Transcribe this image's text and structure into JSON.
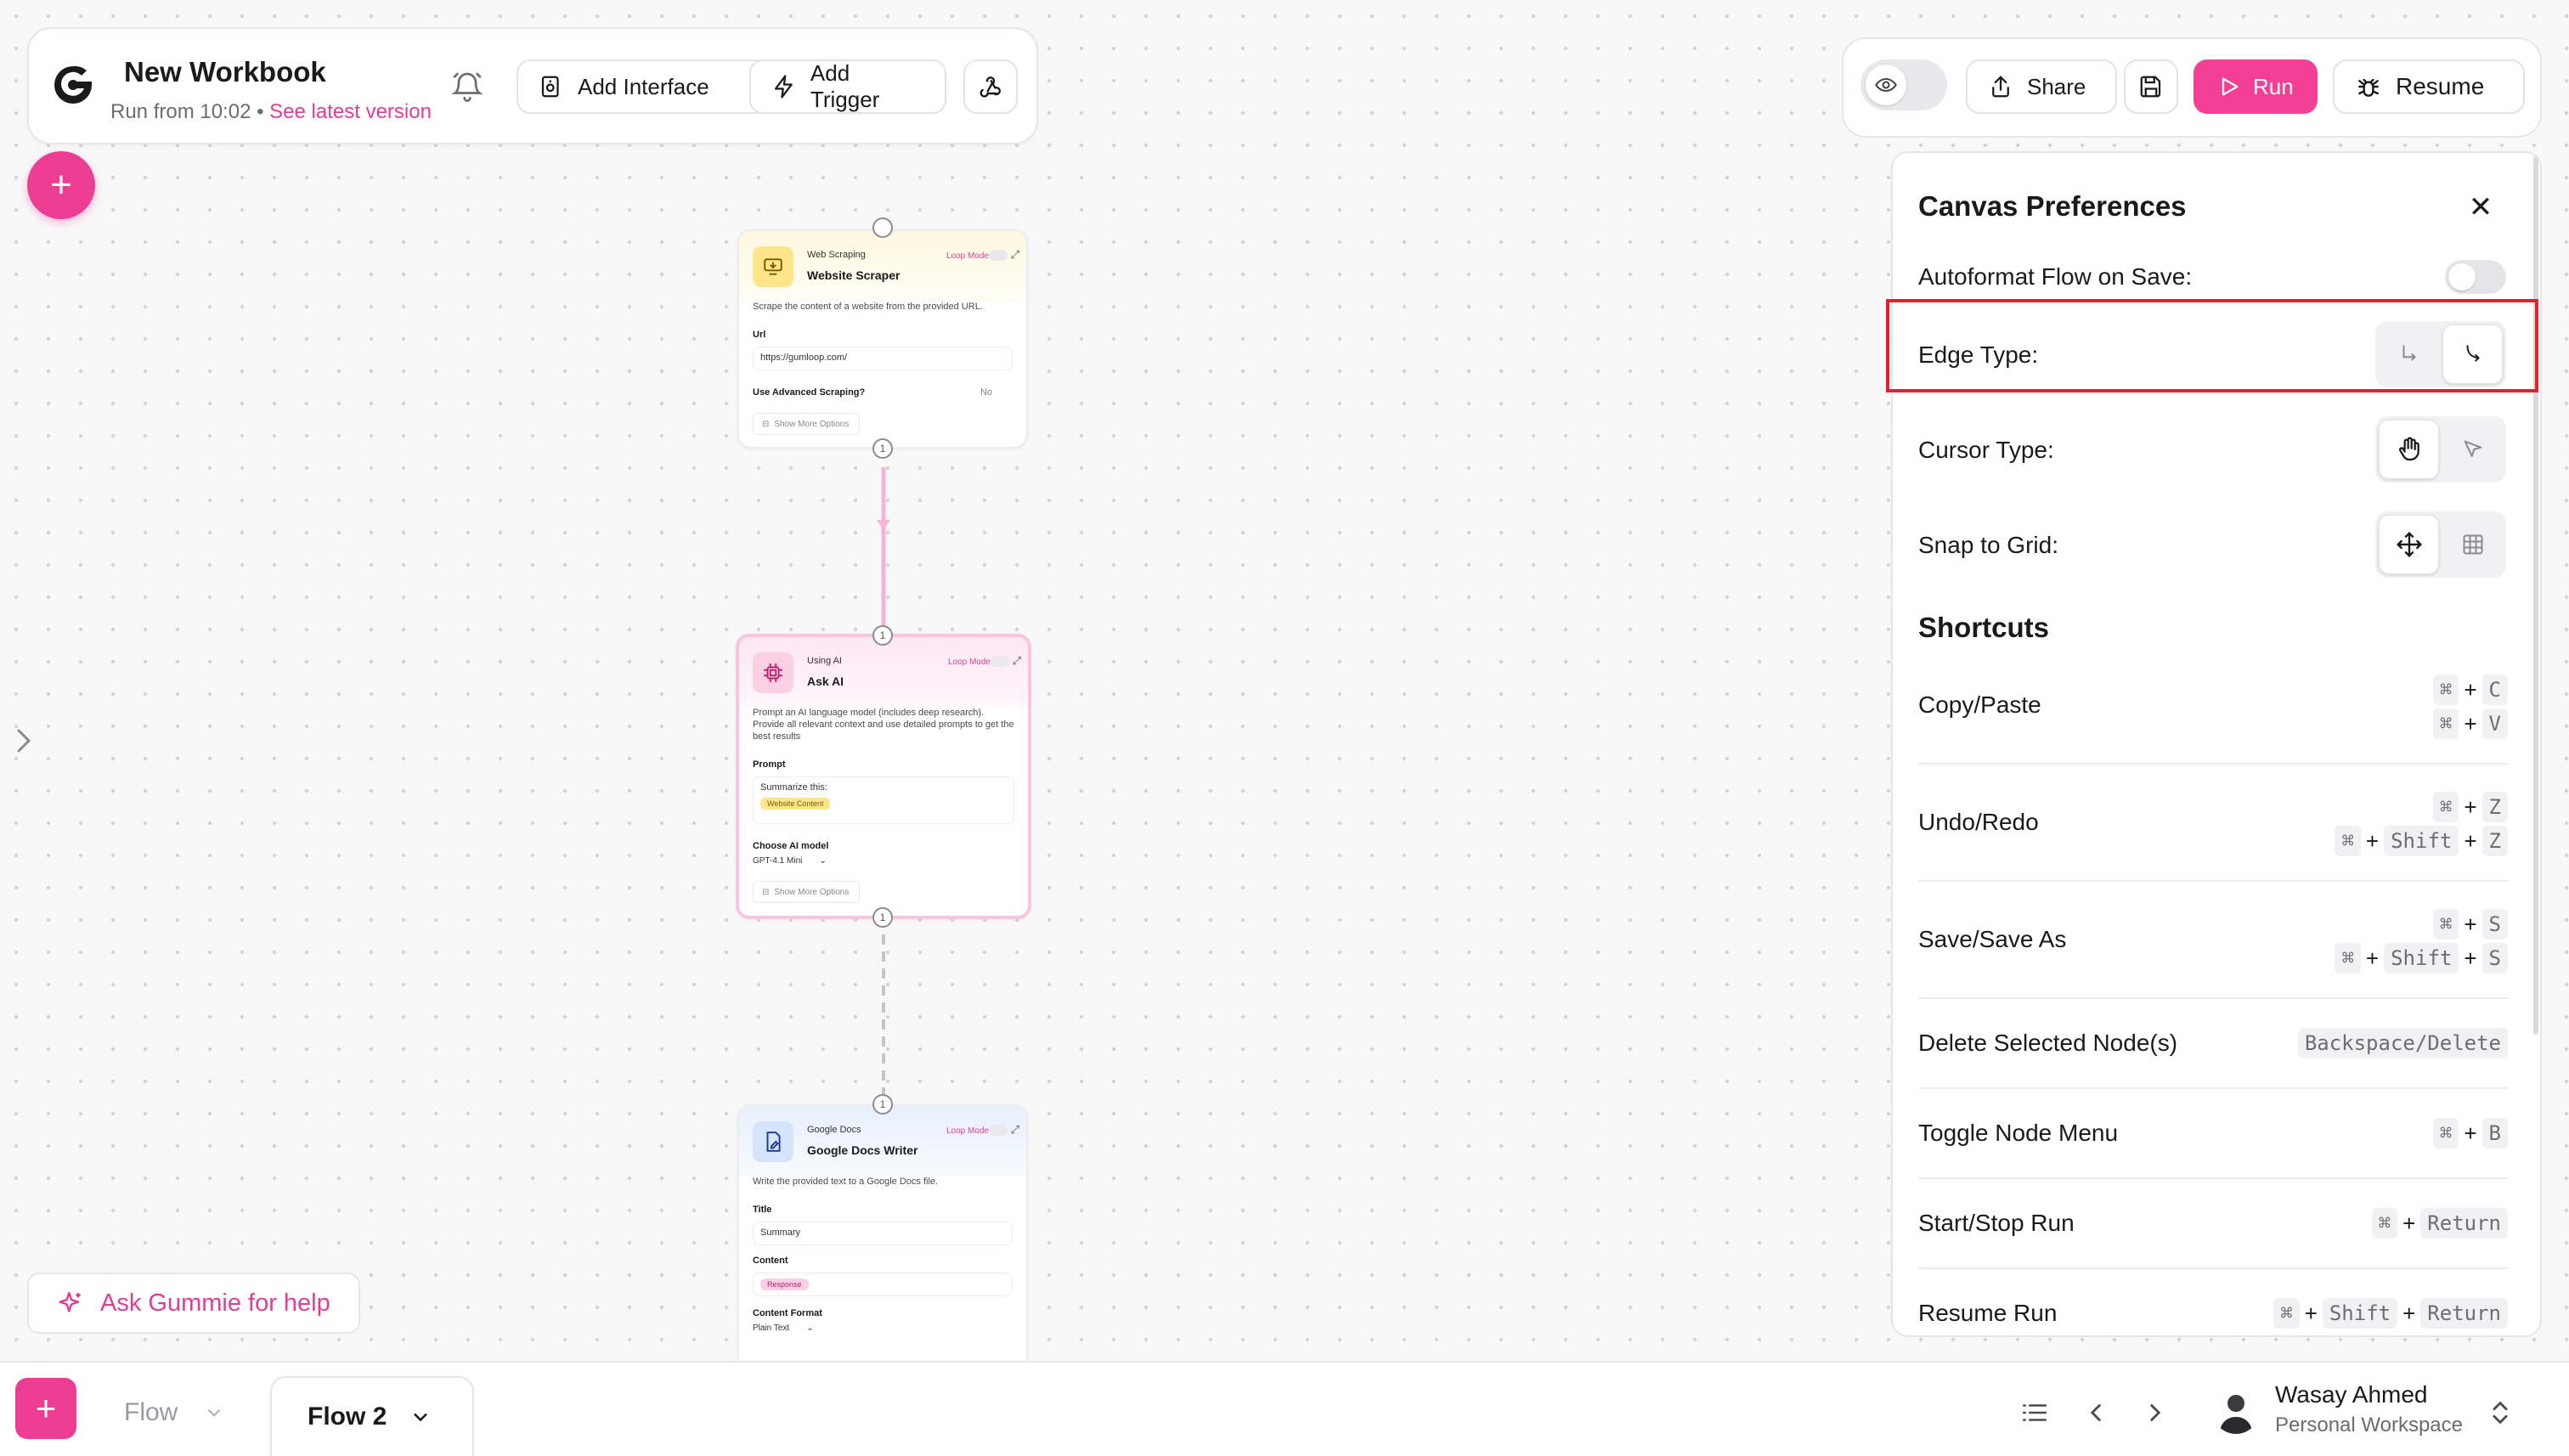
{
  "header": {
    "title": "New Workbook",
    "run_from": "Run from 10:02",
    "separator": "•",
    "latest_link": "See latest version",
    "add_interface": "Add Interface",
    "add_trigger": "Add Trigger"
  },
  "toolbar": {
    "share": "Share",
    "run": "Run",
    "resume": "Resume"
  },
  "preferences": {
    "title": "Canvas Preferences",
    "autoformat_label": "Autoformat Flow on Save:",
    "autoformat_on": false,
    "edge_type_label": "Edge Type:",
    "cursor_type_label": "Cursor Type:",
    "snap_label": "Snap to Grid:",
    "shortcuts_heading": "Shortcuts",
    "shortcuts": [
      {
        "label": "Copy/Paste"
      },
      {
        "label": "Undo/Redo"
      },
      {
        "label": "Save/Save As"
      },
      {
        "label": "Delete Selected Node(s)"
      },
      {
        "label": "Toggle Node Menu"
      },
      {
        "label": "Start/Stop Run"
      },
      {
        "label": "Resume Run"
      }
    ],
    "keys": {
      "cmd": "⌘",
      "plus": "+",
      "c": "C",
      "v": "V",
      "z": "Z",
      "s": "S",
      "b": "B",
      "shift": "Shift",
      "return": "Return",
      "backspace_delete": "Backspace/Delete"
    }
  },
  "nodes": {
    "scraper": {
      "category": "Web Scraping",
      "name": "Website Scraper",
      "loop_mode": "Loop Mode",
      "description": "Scrape the content of a website from the provided URL.",
      "url_label": "Url",
      "url_value": "https://gumloop.com/",
      "advanced_label": "Use Advanced Scraping?",
      "advanced_value": "No",
      "more": "Show More Options",
      "port_in": "",
      "port_out": "1"
    },
    "ask_ai": {
      "category": "Using AI",
      "name": "Ask AI",
      "loop_mode": "Loop Mode",
      "description": "Prompt an AI language model (includes deep research). Provide all relevant context and use detailed prompts to get the best results",
      "prompt_label": "Prompt",
      "prompt_value": "Summarize this:",
      "prompt_pill": "Website Content",
      "model_label": "Choose AI model",
      "model_value": "GPT-4.1 Mini",
      "more": "Show More Options",
      "port_in": "1",
      "port_out": "1"
    },
    "docs": {
      "category": "Google Docs",
      "name": "Google Docs Writer",
      "loop_mode": "Loop Mode",
      "description": "Write the provided text to a Google Docs file.",
      "title_label": "Title",
      "title_value": "Summary",
      "content_label": "Content",
      "content_pill": "Response",
      "format_label": "Content Format",
      "format_value": "Plain Text",
      "port_in": "1"
    }
  },
  "ask_gummie": "Ask Gummie for help",
  "bottom": {
    "tab_flow": "Flow",
    "tab_flow2": "Flow 2",
    "user_name": "Wasay Ahmed",
    "workspace": "Personal Workspace"
  },
  "colors": {
    "brand_pink": "#ec3d93",
    "highlight_red": "#e4202e"
  }
}
